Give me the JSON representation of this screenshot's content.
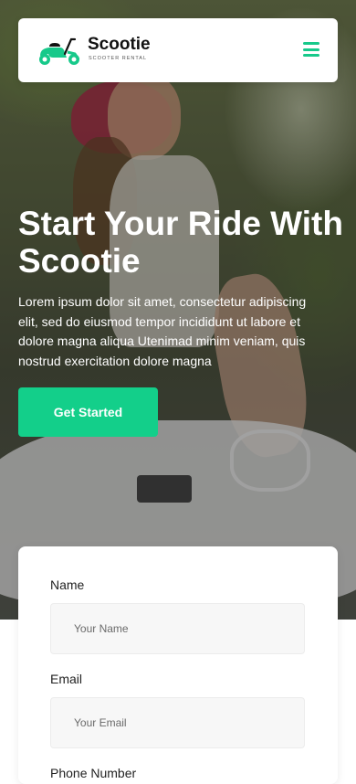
{
  "header": {
    "brand_name": "Scootie",
    "brand_tagline": "SCOOTER RENTAL",
    "logo_icon": "scooter-icon",
    "menu_icon": "hamburger-menu-icon"
  },
  "hero": {
    "title": "Start Your Ride With Scootie",
    "description": "Lorem ipsum dolor sit amet, consectetur adipiscing elit, sed do eiusmod tempor incididunt ut labore et dolore magna aliqua Utenimad minim veniam, quis nostrud exercitation dolore magna",
    "cta_label": "Get Started"
  },
  "form": {
    "fields": [
      {
        "label": "Name",
        "placeholder": "Your Name"
      },
      {
        "label": "Email",
        "placeholder": "Your Email"
      },
      {
        "label": "Phone Number",
        "placeholder": ""
      }
    ]
  },
  "colors": {
    "accent": "#13cf8a",
    "header_bg": "#ffffff",
    "input_bg": "#f7f7f7"
  }
}
